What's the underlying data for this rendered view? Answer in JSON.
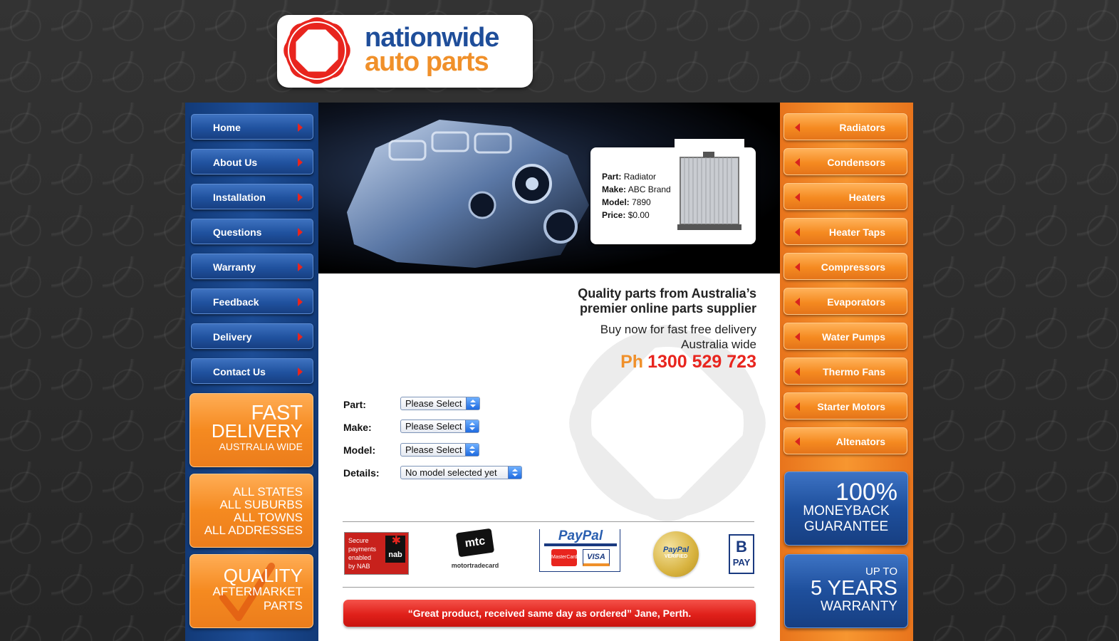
{
  "logo": {
    "line1": "nationwide",
    "line2": "auto parts"
  },
  "left_nav": [
    {
      "label": "Home"
    },
    {
      "label": "About Us"
    },
    {
      "label": "Installation"
    },
    {
      "label": "Questions"
    },
    {
      "label": "Warranty"
    },
    {
      "label": "Feedback"
    },
    {
      "label": "Delivery"
    },
    {
      "label": "Contact Us"
    }
  ],
  "left_promos": {
    "fast_delivery": {
      "line1": "FAST",
      "line2": "DELIVERY",
      "line3": "AUSTRALIA WIDE"
    },
    "coverage": {
      "lines": [
        "ALL STATES",
        "ALL SUBURBS",
        "ALL TOWNS",
        "ALL ADDRESSES"
      ]
    },
    "quality": {
      "line1": "QUALITY",
      "line2": "AFTERMARKET",
      "line3": "PARTS"
    }
  },
  "right_nav": [
    {
      "label": "Radiators"
    },
    {
      "label": "Condensors"
    },
    {
      "label": "Heaters"
    },
    {
      "label": "Heater Taps"
    },
    {
      "label": "Compressors"
    },
    {
      "label": "Evaporators"
    },
    {
      "label": "Water Pumps"
    },
    {
      "label": "Thermo Fans"
    },
    {
      "label": "Starter Motors"
    },
    {
      "label": "Altenators"
    }
  ],
  "right_promos": {
    "moneyback": {
      "line1": "100%",
      "line2": "MONEYBACK",
      "line3": "GUARANTEE"
    },
    "warranty": {
      "line1": "UP TO",
      "line2": "5 YEARS",
      "line3": "WARRANTY"
    }
  },
  "featured_part": {
    "part_label": "Part:",
    "part": "Radiator",
    "make_label": "Make:",
    "make": "ABC Brand",
    "model_label": "Model:",
    "model": "7890",
    "price_label": "Price:",
    "price": "$0.00"
  },
  "tagline": {
    "line1": "Quality parts from Australia’s",
    "line2": "premier online parts supplier",
    "line3": "Buy now for fast free delivery",
    "line4": "Australia wide",
    "phone_prefix": "Ph",
    "phone": "1300 529 723"
  },
  "form": {
    "part_label": "Part:",
    "part_value": "Please Select",
    "make_label": "Make:",
    "make_value": "Please Select",
    "model_label": "Model:",
    "model_value": "Please Select",
    "details_label": "Details:",
    "details_value": "No model selected yet"
  },
  "payment_logos": {
    "nab": {
      "line1": "Secure",
      "line2": "payments",
      "line3": "enabled",
      "line4": "by NAB",
      "brand": "nab"
    },
    "mtc": {
      "brand": "mtc",
      "text": "motortradecard"
    },
    "paypal": {
      "brand": "PayPal",
      "mastercard": "MasterCard",
      "visa": "VISA"
    },
    "paypal_verified": {
      "brand": "PayPal",
      "text": "VERIFIED"
    },
    "bpay": {
      "brand": "PAY"
    }
  },
  "testimonial": "“Great product, received same day as ordered” Jane, Perth.",
  "colors": {
    "brand_blue": "#1f4e9a",
    "brand_orange": "#f0902a",
    "accent_red": "#e8251e"
  }
}
